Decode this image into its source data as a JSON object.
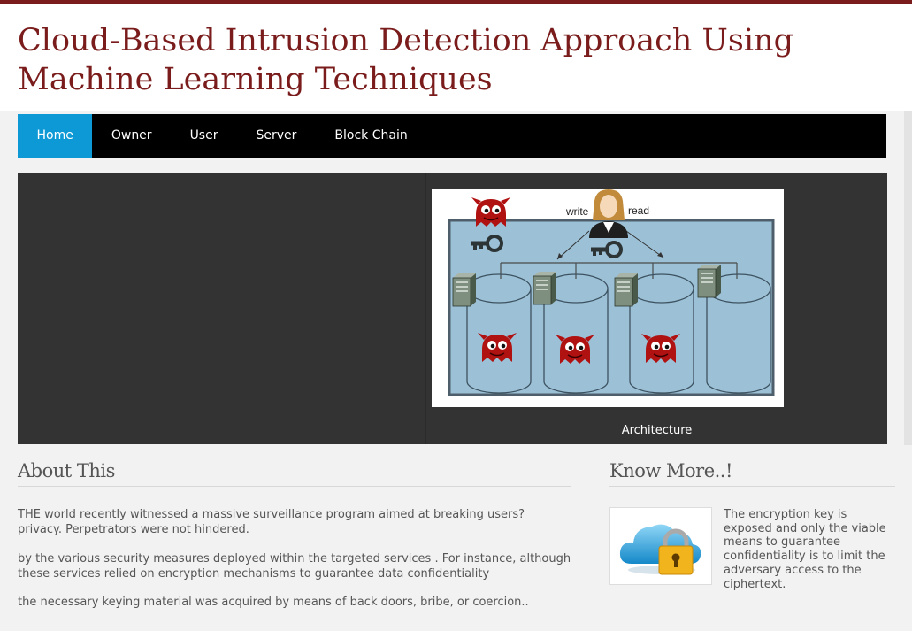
{
  "page": {
    "title": "Cloud-Based Intrusion Detection Approach Using Machine Learning Techniques"
  },
  "nav": {
    "items": [
      {
        "label": "Home",
        "active": true
      },
      {
        "label": "Owner"
      },
      {
        "label": "User"
      },
      {
        "label": "Server"
      },
      {
        "label": "Block Chain"
      }
    ]
  },
  "slider": {
    "caption": "Architecture",
    "figure": {
      "write_label": "write",
      "read_label": "read"
    }
  },
  "about": {
    "title": "About This",
    "paragraphs": [
      "THE world recently witnessed a massive surveillance program aimed at breaking users? privacy. Perpetrators were not hindered.",
      "by the various security measures deployed within the targeted services . For instance, although these services relied on encryption mechanisms to guarantee data confidentiality",
      "the necessary keying material was acquired by means of back doors, bribe, or coercion.."
    ]
  },
  "know_more": {
    "title": "Know More..!",
    "text": "The encryption key is exposed and only the viable means to guarantee confidentiality is to limit the adversary access to the ciphertext."
  },
  "colors": {
    "brand": "#7a1c1c",
    "nav_active": "#0d99d5",
    "nav_bg": "#000000",
    "slider_bg": "#333333"
  },
  "icons": [
    "devil-icon",
    "key-icon",
    "user-icon",
    "server-icon",
    "database-icon",
    "cloud-lock-icon"
  ]
}
